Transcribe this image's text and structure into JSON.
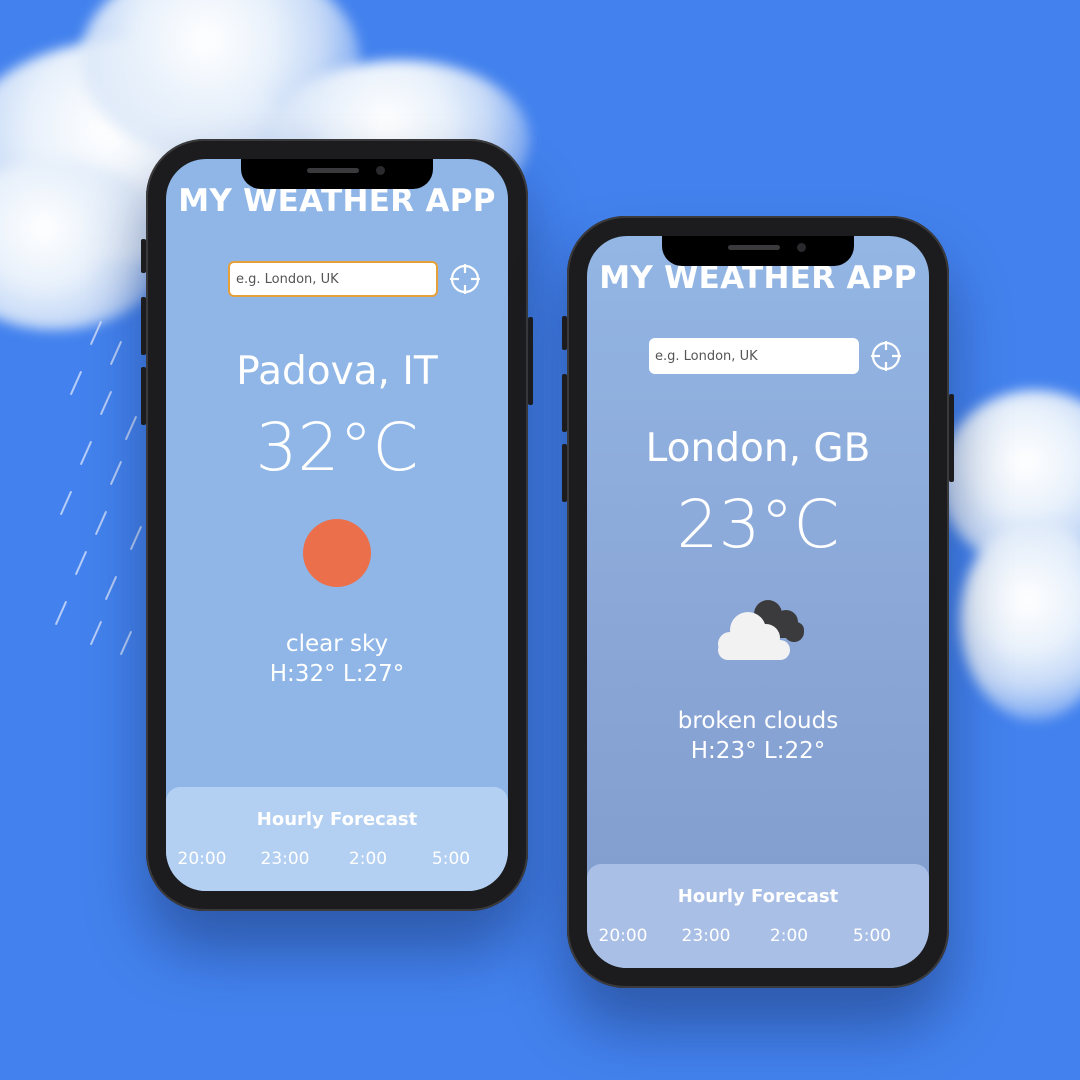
{
  "colors": {
    "background": "#4382ee",
    "sun": "#ec6f4b",
    "focus_ring": "#e5a03a",
    "dark_icon": "#3b3b3d"
  },
  "screens": [
    {
      "app_title": "MY WEATHER APP",
      "search": {
        "placeholder": "e.g. London, UK",
        "value": "",
        "focused": true
      },
      "city": "Padova, IT",
      "temperature": "32°C",
      "condition_icon": "sun-icon",
      "description": "clear sky",
      "high_low": "H:32° L:27°",
      "hourly": {
        "title": "Hourly Forecast",
        "items": [
          {
            "time": "20:00",
            "icon": "sun-icon"
          },
          {
            "time": "23:00",
            "icon": "moon-icon"
          },
          {
            "time": "2:00",
            "icon": "moon-icon"
          },
          {
            "time": "5:00",
            "icon": "moon-icon"
          }
        ]
      }
    },
    {
      "app_title": "MY WEATHER APP",
      "search": {
        "placeholder": "e.g. London, UK",
        "value": "",
        "focused": false
      },
      "city": "London, GB",
      "temperature": "23°C",
      "condition_icon": "broken-clouds-icon",
      "description": "broken clouds",
      "high_low": "H:23° L:22°",
      "hourly": {
        "title": "Hourly Forecast",
        "items": [
          {
            "time": "20:00",
            "icon": "broken-clouds-icon"
          },
          {
            "time": "23:00",
            "icon": "cloud-icon"
          },
          {
            "time": "2:00",
            "icon": "moon-icon"
          },
          {
            "time": "5:00",
            "icon": "moon-icon"
          }
        ]
      }
    }
  ]
}
